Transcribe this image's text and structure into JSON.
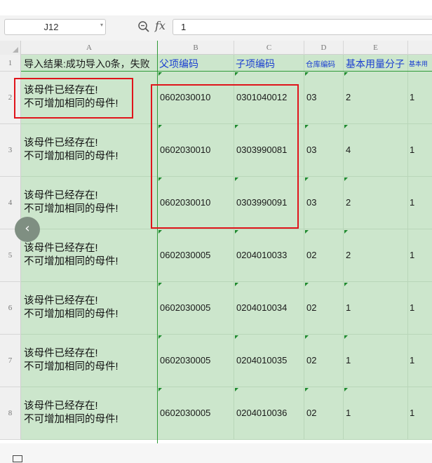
{
  "toolbar": {
    "name_box": "J12",
    "formula_value": "1"
  },
  "columns": [
    "A",
    "B",
    "C",
    "D",
    "E"
  ],
  "rows": [
    {
      "num": "1",
      "a": "导入结果:成功导入0条，失败",
      "b": "父项编码",
      "c": "子项编码",
      "d": "仓库编码",
      "e": "基本用量分子",
      "f": "基本用"
    },
    {
      "num": "2",
      "a1": "该母件已经存在!",
      "a2": "不可增加相同的母件!",
      "b": "0602030010",
      "c": "0301040012",
      "d": "03",
      "e": "2",
      "f": "1"
    },
    {
      "num": "3",
      "a1": "该母件已经存在!",
      "a2": "不可增加相同的母件!",
      "b": "0602030010",
      "c": "0303990081",
      "d": "03",
      "e": "4",
      "f": "1"
    },
    {
      "num": "4",
      "a1": "该母件已经存在!",
      "a2": "不可增加相同的母件!",
      "b": "0602030010",
      "c": "0303990091",
      "d": "03",
      "e": "2",
      "f": "1"
    },
    {
      "num": "5",
      "a1": "该母件已经存在!",
      "a2": "不可增加相同的母件!",
      "b": "0602030005",
      "c": "0204010033",
      "d": "02",
      "e": "2",
      "f": "1"
    },
    {
      "num": "6",
      "a1": "该母件已经存在!",
      "a2": "不可增加相同的母件!",
      "b": "0602030005",
      "c": "0204010034",
      "d": "02",
      "e": "1",
      "f": "1"
    },
    {
      "num": "7",
      "a1": "该母件已经存在!",
      "a2": "不可增加相同的母件!",
      "b": "0602030005",
      "c": "0204010035",
      "d": "02",
      "e": "1",
      "f": "1"
    },
    {
      "num": "8",
      "a1": "该母件已经存在!",
      "a2": "不可增加相同的母件!",
      "b": "0602030005",
      "c": "0204010036",
      "d": "02",
      "e": "1",
      "f": "1"
    }
  ],
  "icons": {
    "zoom": "zoom-icon",
    "fx": "fx",
    "nav": "‹"
  },
  "colors": {
    "cell_fill": "#cce6cc",
    "highlight_box": "#e0141b",
    "header_text": "#1b3fd1"
  }
}
